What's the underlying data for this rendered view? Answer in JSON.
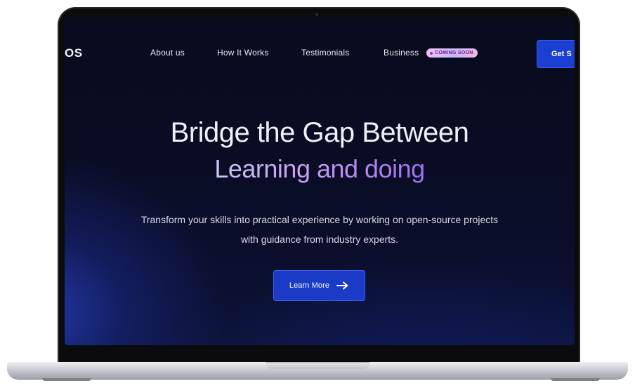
{
  "nav": {
    "logo": "OS",
    "links": [
      "About us",
      "How It Works",
      "Testimonials",
      "Business"
    ],
    "badge": "COMING SOON",
    "cta": "Get S"
  },
  "hero": {
    "title": "Bridge the Gap Between",
    "subtitle": "Learning and doing",
    "description_line1": "Transform your skills into practical experience by working on open-source projects",
    "description_line2": "with guidance from industry experts.",
    "button_label": "Learn More",
    "button_icon": "arrow-right-icon"
  },
  "colors": {
    "background": "#0a0d26",
    "accent_blue": "#1a3bc6",
    "gradient_text_start": "#c4c8f6",
    "gradient_text_end": "#9b6ff0",
    "badge_bg": "#e7bdf6"
  }
}
